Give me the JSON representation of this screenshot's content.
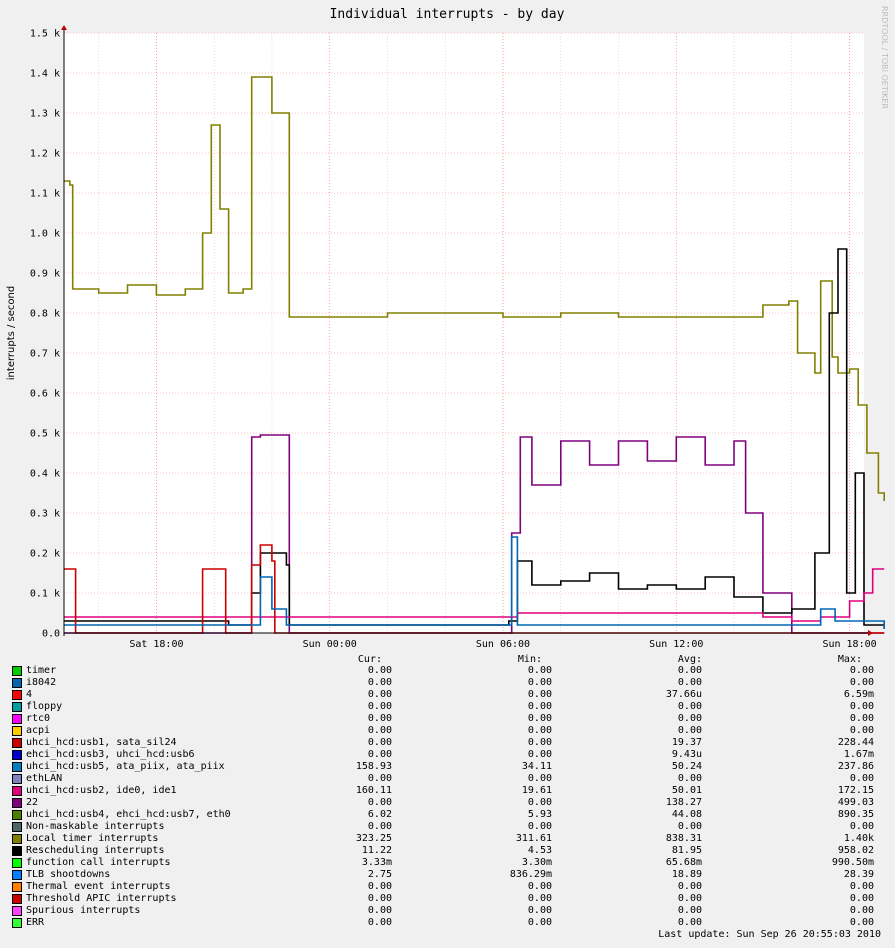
{
  "chart_data": {
    "type": "line",
    "title": "Individual interrupts - by day",
    "ylabel": "interrupts / second",
    "ylim": [
      0,
      1500
    ],
    "y_ticks": [
      "0.0",
      "0.1 k",
      "0.2 k",
      "0.3 k",
      "0.4 k",
      "0.5 k",
      "0.6 k",
      "0.7 k",
      "0.8 k",
      "0.9 k",
      "1.0 k",
      "1.1 k",
      "1.2 k",
      "1.3 k",
      "1.4 k",
      "1.5 k"
    ],
    "x_range_hours": [
      14.8,
      42.5
    ],
    "x_ticks": [
      {
        "label": "Sat 18:00",
        "hour": 18
      },
      {
        "label": "Sun 00:00",
        "hour": 24
      },
      {
        "label": "Sun 06:00",
        "hour": 30
      },
      {
        "label": "Sun 12:00",
        "hour": 36
      },
      {
        "label": "Sun 18:00",
        "hour": 42
      }
    ],
    "grid": true,
    "series": [
      {
        "name": "Local timer interrupts",
        "color": "#808000",
        "points": [
          [
            14.8,
            1130
          ],
          [
            15.0,
            1120
          ],
          [
            15.1,
            860
          ],
          [
            16.0,
            850
          ],
          [
            17.0,
            870
          ],
          [
            18.0,
            845
          ],
          [
            19.0,
            860
          ],
          [
            19.6,
            1000
          ],
          [
            19.9,
            1270
          ],
          [
            20.2,
            1060
          ],
          [
            20.5,
            850
          ],
          [
            21.0,
            860
          ],
          [
            21.3,
            1390
          ],
          [
            21.6,
            1390
          ],
          [
            22.0,
            1300
          ],
          [
            22.5,
            1300
          ],
          [
            22.6,
            790
          ],
          [
            23.5,
            790
          ],
          [
            24.0,
            790
          ],
          [
            26.0,
            800
          ],
          [
            28.0,
            800
          ],
          [
            30.0,
            790
          ],
          [
            32.0,
            800
          ],
          [
            34.0,
            790
          ],
          [
            36.0,
            790
          ],
          [
            38.0,
            790
          ],
          [
            39.0,
            820
          ],
          [
            39.9,
            830
          ],
          [
            40.2,
            700
          ],
          [
            40.8,
            650
          ],
          [
            41.0,
            880
          ],
          [
            41.3,
            880
          ],
          [
            41.4,
            690
          ],
          [
            41.6,
            650
          ],
          [
            42.0,
            660
          ],
          [
            42.3,
            570
          ],
          [
            42.6,
            450
          ],
          [
            43.0,
            350
          ],
          [
            43.2,
            330
          ]
        ]
      },
      {
        "name": "22",
        "color": "#800080",
        "points": [
          [
            14.8,
            0
          ],
          [
            21.2,
            0
          ],
          [
            21.3,
            490
          ],
          [
            21.6,
            495
          ],
          [
            22.5,
            495
          ],
          [
            22.6,
            0
          ],
          [
            30.2,
            0
          ],
          [
            30.3,
            250
          ],
          [
            30.6,
            490
          ],
          [
            31.0,
            370
          ],
          [
            32.0,
            480
          ],
          [
            33.0,
            420
          ],
          [
            34.0,
            480
          ],
          [
            35.0,
            430
          ],
          [
            36.0,
            490
          ],
          [
            37.0,
            420
          ],
          [
            38.0,
            480
          ],
          [
            38.4,
            300
          ],
          [
            39.0,
            100
          ],
          [
            40.0,
            0
          ],
          [
            43.2,
            0
          ]
        ]
      },
      {
        "name": "Rescheduling interrupts",
        "color": "#000000",
        "points": [
          [
            14.8,
            30
          ],
          [
            20.5,
            20
          ],
          [
            21.3,
            100
          ],
          [
            21.6,
            200
          ],
          [
            22.5,
            170
          ],
          [
            22.6,
            20
          ],
          [
            30.2,
            30
          ],
          [
            30.5,
            180
          ],
          [
            31.0,
            120
          ],
          [
            32.0,
            130
          ],
          [
            33.0,
            150
          ],
          [
            34.0,
            110
          ],
          [
            35.0,
            120
          ],
          [
            36.0,
            110
          ],
          [
            37.0,
            140
          ],
          [
            38.0,
            90
          ],
          [
            39.0,
            50
          ],
          [
            40.0,
            60
          ],
          [
            40.8,
            200
          ],
          [
            41.3,
            800
          ],
          [
            41.6,
            960
          ],
          [
            41.9,
            100
          ],
          [
            42.2,
            400
          ],
          [
            42.5,
            20
          ],
          [
            43.2,
            10
          ]
        ]
      },
      {
        "name": "uhci_hcd:usb2, ide0, ide1",
        "color": "#e0007f",
        "points": [
          [
            14.8,
            40
          ],
          [
            20.0,
            40
          ],
          [
            24.0,
            40
          ],
          [
            30.0,
            40
          ],
          [
            30.5,
            50
          ],
          [
            36.0,
            50
          ],
          [
            38.0,
            50
          ],
          [
            39.0,
            40
          ],
          [
            40.0,
            30
          ],
          [
            41.0,
            40
          ],
          [
            42.0,
            80
          ],
          [
            42.5,
            100
          ],
          [
            42.8,
            160
          ],
          [
            43.2,
            160
          ]
        ]
      },
      {
        "name": "uhci_hcd:usb1, sata_sil24",
        "color": "#cc0000",
        "points": [
          [
            14.8,
            160
          ],
          [
            15.1,
            160
          ],
          [
            15.2,
            0
          ],
          [
            19.5,
            0
          ],
          [
            19.6,
            160
          ],
          [
            20.3,
            160
          ],
          [
            20.4,
            0
          ],
          [
            21.2,
            0
          ],
          [
            21.3,
            170
          ],
          [
            21.6,
            220
          ],
          [
            22.0,
            180
          ],
          [
            22.1,
            0
          ],
          [
            43.2,
            0
          ]
        ]
      },
      {
        "name": "uhci_hcd:usb5, ata_piix, ata_piix",
        "color": "#0066b3",
        "points": [
          [
            14.8,
            20
          ],
          [
            21.0,
            20
          ],
          [
            21.6,
            140
          ],
          [
            22.0,
            60
          ],
          [
            22.5,
            20
          ],
          [
            30.2,
            20
          ],
          [
            30.3,
            240
          ],
          [
            30.5,
            20
          ],
          [
            36.0,
            20
          ],
          [
            40.8,
            20
          ],
          [
            41.0,
            60
          ],
          [
            41.5,
            30
          ],
          [
            43.2,
            10
          ]
        ]
      }
    ]
  },
  "legend_headers": {
    "cur": "Cur:",
    "min": "Min:",
    "avg": "Avg:",
    "max": "Max:"
  },
  "legend": [
    {
      "name": "timer",
      "color": "#00cc00",
      "cur": "0.00",
      "min": "0.00",
      "avg": "0.00",
      "max": "0.00"
    },
    {
      "name": "i8042",
      "color": "#0066b3",
      "cur": "0.00",
      "min": "0.00",
      "avg": "0.00",
      "max": "0.00"
    },
    {
      "name": "4",
      "color": "#ff0000",
      "cur": "0.00",
      "min": "0.00",
      "avg": "37.66u",
      "max": "6.59m"
    },
    {
      "name": "floppy",
      "color": "#00a0a0",
      "cur": "0.00",
      "min": "0.00",
      "avg": "0.00",
      "max": "0.00"
    },
    {
      "name": "rtc0",
      "color": "#ff00ff",
      "cur": "0.00",
      "min": "0.00",
      "avg": "0.00",
      "max": "0.00"
    },
    {
      "name": "acpi",
      "color": "#ffcc00",
      "cur": "0.00",
      "min": "0.00",
      "avg": "0.00",
      "max": "0.00"
    },
    {
      "name": "uhci_hcd:usb1, sata_sil24",
      "color": "#cc0000",
      "cur": "0.00",
      "min": "0.00",
      "avg": "19.37",
      "max": "228.44"
    },
    {
      "name": "ehci_hcd:usb3, uhci_hcd:usb6",
      "color": "#0000cc",
      "cur": "0.00",
      "min": "0.00",
      "avg": "9.43u",
      "max": "1.67m"
    },
    {
      "name": "uhci_hcd:usb5, ata_piix, ata_piix",
      "color": "#0080c0",
      "cur": "158.93",
      "min": "34.11",
      "avg": "50.24",
      "max": "237.86"
    },
    {
      "name": "ethLAN",
      "color": "#8080c0",
      "cur": "0.00",
      "min": "0.00",
      "avg": "0.00",
      "max": "0.00"
    },
    {
      "name": "uhci_hcd:usb2, ide0, ide1",
      "color": "#e0007f",
      "cur": "160.11",
      "min": "19.61",
      "avg": "50.01",
      "max": "172.15"
    },
    {
      "name": "22",
      "color": "#800080",
      "cur": "0.00",
      "min": "0.00",
      "avg": "138.27",
      "max": "499.03"
    },
    {
      "name": "uhci_hcd:usb4, ehci_hcd:usb7, eth0",
      "color": "#4d8000",
      "cur": "6.02",
      "min": "5.93",
      "avg": "44.08",
      "max": "890.35"
    },
    {
      "name": "Non-maskable interrupts",
      "color": "#4d6666",
      "cur": "0.00",
      "min": "0.00",
      "avg": "0.00",
      "max": "0.00"
    },
    {
      "name": "Local timer interrupts",
      "color": "#808000",
      "cur": "323.25",
      "min": "311.61",
      "avg": "838.31",
      "max": "1.40k"
    },
    {
      "name": "Rescheduling interrupts",
      "color": "#000000",
      "cur": "11.22",
      "min": "4.53",
      "avg": "81.95",
      "max": "958.02"
    },
    {
      "name": "function call interrupts",
      "color": "#00ff00",
      "cur": "3.33m",
      "min": "3.30m",
      "avg": "65.68m",
      "max": "990.50m"
    },
    {
      "name": "TLB shootdowns",
      "color": "#0080ff",
      "cur": "2.75",
      "min": "836.29m",
      "avg": "18.89",
      "max": "28.39"
    },
    {
      "name": "Thermal event interrupts",
      "color": "#ff8000",
      "cur": "0.00",
      "min": "0.00",
      "avg": "0.00",
      "max": "0.00"
    },
    {
      "name": "Threshold APIC interrupts",
      "color": "#cc0000",
      "cur": "0.00",
      "min": "0.00",
      "avg": "0.00",
      "max": "0.00"
    },
    {
      "name": "Spurious interrupts",
      "color": "#ff40ff",
      "cur": "0.00",
      "min": "0.00",
      "avg": "0.00",
      "max": "0.00"
    },
    {
      "name": "ERR",
      "color": "#33ff33",
      "cur": "0.00",
      "min": "0.00",
      "avg": "0.00",
      "max": "0.00"
    }
  ],
  "last_update": "Last update:  Sun Sep 26 20:55:03 2010",
  "watermark": "RRDTOOL / TOBI OETIKER"
}
